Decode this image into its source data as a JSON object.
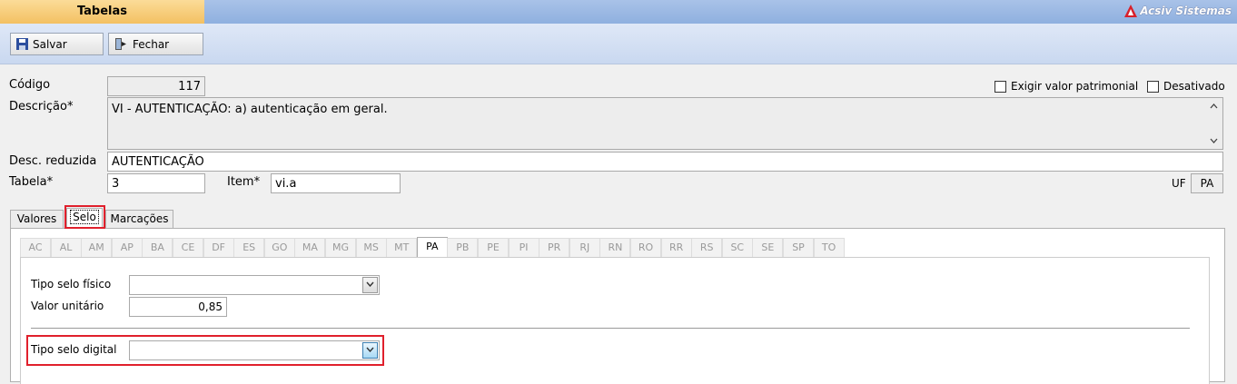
{
  "header": {
    "title": "Tabelas",
    "brand": "Acsiv Sistemas"
  },
  "toolbar": {
    "save_label": "Salvar",
    "close_label": "Fechar"
  },
  "form": {
    "codigo_label": "Código",
    "codigo_value": "117",
    "descricao_label": "Descrição*",
    "descricao_value": "VI - AUTENTICAÇÃO: a) autenticação em geral.",
    "desc_reduzida_label": "Desc. reduzida",
    "desc_reduzida_value": "AUTENTICAÇÃO",
    "tabela_label": "Tabela*",
    "tabela_value": "3",
    "item_label": "Item*",
    "item_value": "vi.a",
    "uf_label": "UF",
    "uf_value": "PA",
    "exigir_label": "Exigir valor patrimonial",
    "desativado_label": "Desativado"
  },
  "tabs": [
    "Valores",
    "Selo",
    "Marcações"
  ],
  "uf_tabs": [
    "AC",
    "AL",
    "AM",
    "AP",
    "BA",
    "CE",
    "DF",
    "ES",
    "GO",
    "MA",
    "MG",
    "MS",
    "MT",
    "PA",
    "PB",
    "PE",
    "PI",
    "PR",
    "RJ",
    "RN",
    "RO",
    "RR",
    "RS",
    "SC",
    "SE",
    "SP",
    "TO"
  ],
  "selo": {
    "tipo_fisico_label": "Tipo selo físico",
    "tipo_fisico_value": "",
    "valor_unitario_label": "Valor unitário",
    "valor_unitario_value": "0,85",
    "tipo_digital_label": "Tipo selo digital",
    "tipo_digital_value": ""
  },
  "colors": {
    "highlight": "#e0202c",
    "title_tab": "#f3c062",
    "titlebar": "#8fb0df"
  }
}
